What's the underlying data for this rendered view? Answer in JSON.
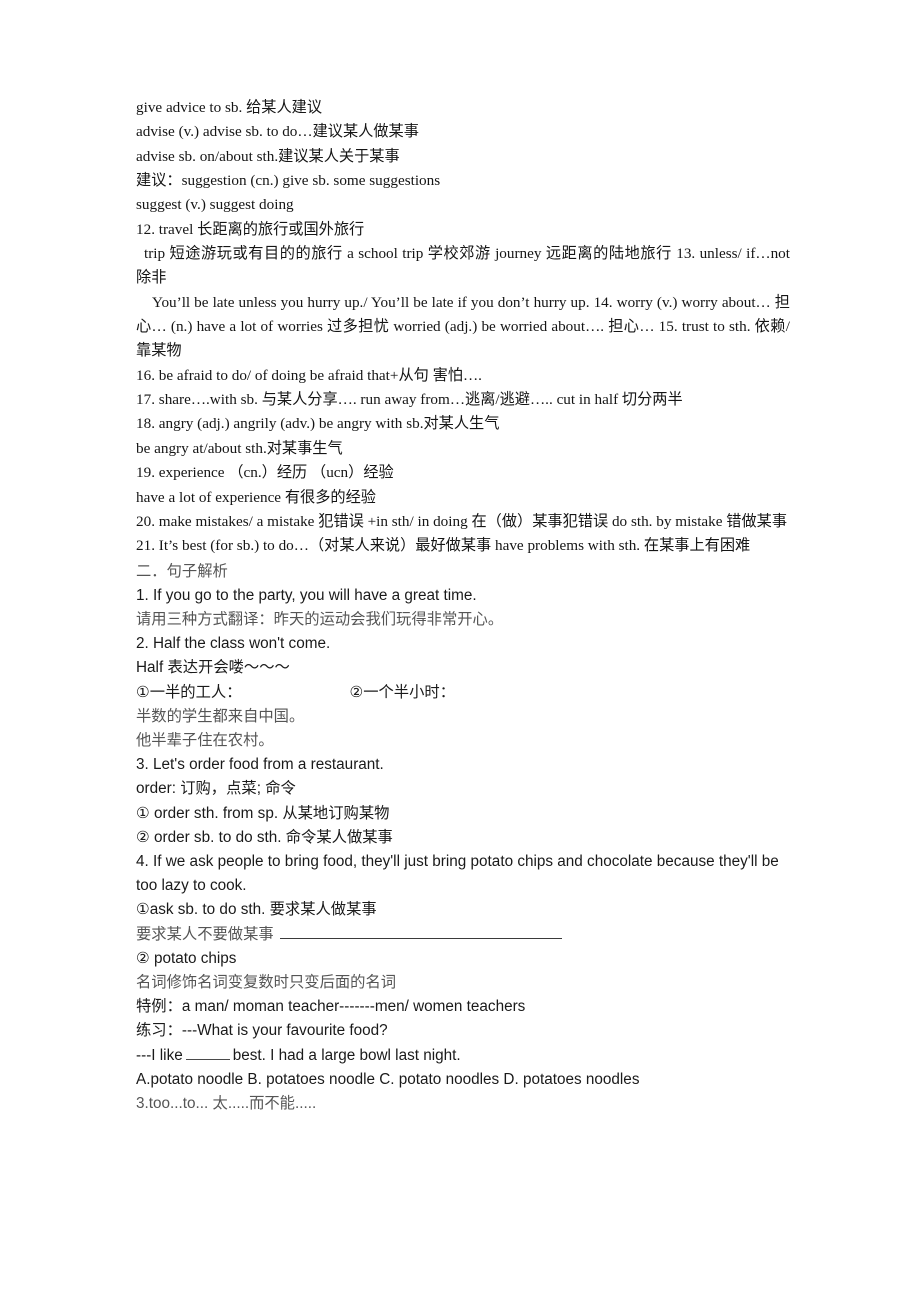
{
  "document": {
    "title": "英语语法笔记 — 短语与句子解析",
    "page_background": "#ffffff",
    "text_color": "#151515"
  },
  "vocabulary_section": {
    "font_style": "serif",
    "lines": [
      {
        "id": "l1",
        "text": "give advice to sb. 给某人建议"
      },
      {
        "id": "l2",
        "text": " advise (v.)        advise sb. to do…建议某人做某事"
      },
      {
        "id": "l3",
        "text": "advise sb. on/about sth.建议某人关于某事"
      },
      {
        "id": "l4",
        "text": "建议：suggestion (cn.)  give sb. some suggestions"
      },
      {
        "id": "l5",
        "text": "suggest (v.)      suggest doing"
      },
      {
        "id": "l6",
        "text": "12. travel 长距离的旅行或国外旅行"
      },
      {
        "id": "l7",
        "text": "  trip 短途游玩或有目的的旅行  a school trip 学校郊游   journey 远距离的陆地旅行 13. unless/ if…not 除非"
      },
      {
        "id": "l8",
        "text": "  You’ll be late unless you hurry up./ You’ll be late if you don’t hurry up. 14. worry (v.)  worry about… 担心…   (n.) have a lot of worries 过多担忧   worried (adj.) be worried about…. 担心… 15. trust to sth. 依赖/靠某物"
      },
      {
        "id": "l9",
        "text": "16. be afraid to do/ of doing   be afraid that+从句 害怕…."
      },
      {
        "id": "l10",
        "text": "17. share….with sb. 与某人分享…. run away from…逃离/逃避….. cut in half     切分两半"
      },
      {
        "id": "l11",
        "text": "18. angry (adj.) angrily (adv.)  be angry with sb.对某人生气"
      },
      {
        "id": "l12",
        "text": "be angry at/about sth.对某事生气"
      },
      {
        "id": "l13",
        "text": "19. experience （cn.）经历 （ucn）经验"
      },
      {
        "id": "l14",
        "text": "have a lot of experience 有很多的经验"
      },
      {
        "id": "l15",
        "text": "20. make mistakes/ a mistake  犯错误  +in sth/ in doing 在（做）某事犯错误   do sth. by mistake 错做某事"
      },
      {
        "id": "l16",
        "text": "21. It’s best (for sb.) to do…（对某人来说）最好做某事   have problems with sth. 在某事上有困难"
      }
    ]
  },
  "sentence_analysis_section": {
    "font_style": "sans",
    "heading": "二．句子解析",
    "items": {
      "item1_sentence": "1. If you go to the party, you will have a great time.",
      "item1_task": "请用三种方式翻译：昨天的运动会我们玩得非常开心。",
      "item2_sentence": "2. Half the class won't come.",
      "item2_note": "Half 表达开会喽～～～",
      "item2_sub1": "①一半的工人：",
      "item2_sub2": "②一个半小时：",
      "item2_ex1": "半数的学生都来自中国。",
      "item2_ex2": "他半辈子住在农村。",
      "item3_sentence": "3. Let's order food from a restaurant.",
      "item3_gloss": "order: 订购，点菜; 命令",
      "item3_sub1": "① order sth. from sp.   从某地订购某物",
      "item3_sub2": "② order sb. to do sth.   命令某人做某事",
      "item4_sentence": "4. If we ask people to bring food, they'll just bring potato chips and chocolate because they'll be too lazy to cook.",
      "item4_sub1": "①ask sb. to do sth.   要求某人做某事",
      "item4_blank_label": "要求某人不要做某事",
      "item4_sub2": "② potato chips",
      "item4_rule": "名词修饰名词变复数时只变后面的名词",
      "item4_special": "特例：a man/ moman teacher-------men/ women teachers",
      "item4_practice_q": "练习：---What is your favourite food?",
      "item4_practice_a_pre": "---I like",
      "item4_practice_a_post": "best. I had a large bowl last night.",
      "item4_choices": "A.potato noodle B. potatoes noodle  C. potato noodles  D. potatoes noodles",
      "item5_sentence": "3.too...to...  太.....而不能....."
    }
  }
}
